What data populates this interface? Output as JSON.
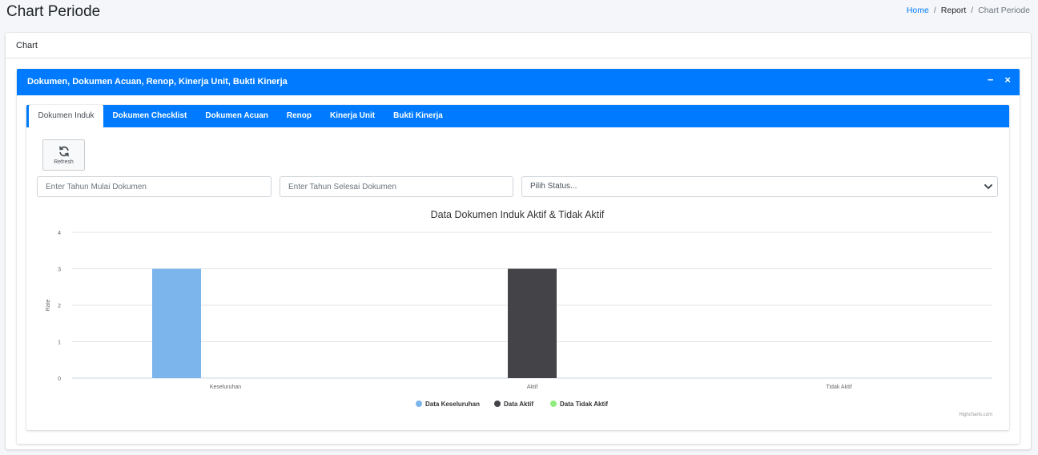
{
  "page": {
    "title": "Chart Periode"
  },
  "breadcrumb": {
    "home": "Home",
    "sep1": "/",
    "report": "Report",
    "sep2": "/",
    "current": "Chart Periode"
  },
  "outer_card": {
    "title": "Chart"
  },
  "panel": {
    "title": "Dokumen, Dokumen Acuan, Renop, Kinerja Unit, Bukti Kinerja",
    "minimize": "−",
    "close": "×"
  },
  "tabs": [
    {
      "label": "Dokumen Induk",
      "active": true
    },
    {
      "label": "Dokumen Checklist",
      "active": false
    },
    {
      "label": "Dokumen Acuan",
      "active": false
    },
    {
      "label": "Renop",
      "active": false
    },
    {
      "label": "Kinerja Unit",
      "active": false
    },
    {
      "label": "Bukti Kinerja",
      "active": false
    }
  ],
  "toolbar": {
    "refresh_label": "Refresh",
    "refresh_icon": "refresh-icon"
  },
  "filters": {
    "start_year_placeholder": "Enter Tahun Mulai Dokumen",
    "end_year_placeholder": "Enter Tahun Selesai Dokumen",
    "status_value": "Pilih Status..."
  },
  "chart_data": {
    "type": "bar",
    "title": "Data Dokumen Induk Aktif & Tidak Aktif",
    "ylabel": "Rate",
    "xlabel": "",
    "categories": [
      "Keseluruhan",
      "Aktif",
      "Tidak Aktif"
    ],
    "yticks": [
      0,
      1,
      2,
      3,
      4
    ],
    "ylim": [
      0,
      4
    ],
    "grid": true,
    "legend_position": "bottom",
    "series": [
      {
        "name": "Data Keseluruhan",
        "color": "#7cb5ec",
        "values": [
          3,
          0,
          0
        ]
      },
      {
        "name": "Data Aktif",
        "color": "#434348",
        "values": [
          0,
          3,
          0
        ]
      },
      {
        "name": "Data Tidak Aktif",
        "color": "#90ed7d",
        "values": [
          0,
          0,
          0
        ]
      }
    ],
    "credits": "Highcharts.com"
  }
}
